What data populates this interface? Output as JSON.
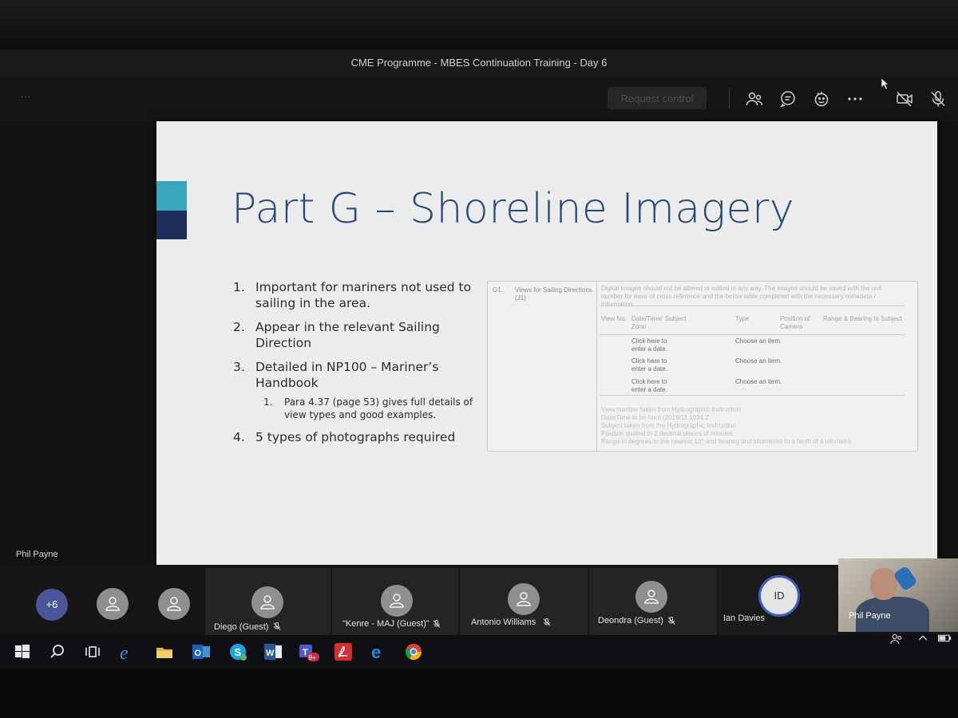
{
  "window": {
    "title": "CME Programme - MBES Continuation Training - Day 6"
  },
  "toolbar": {
    "request_control_label": "Request control",
    "left_indicator": "···"
  },
  "slide": {
    "title": "Part G – Shoreline Imagery",
    "bullets": [
      {
        "num": "1.",
        "text": "Important for mariners not used to sailing in the area."
      },
      {
        "num": "2.",
        "text": "Appear in the relevant Sailing Direction"
      },
      {
        "num": "3.",
        "text": "Detailed in NP100 – Mariner’s Handbook"
      },
      {
        "num": "1.",
        "text": "Para 4.37 (page 53) gives full details of view types and good examples.",
        "sub": true
      },
      {
        "num": "4.",
        "text": "5 types of photographs required"
      }
    ],
    "form": {
      "code": "G1.",
      "label": "Views for Sailing Directions (J1)",
      "note": "Digital images should not be altered or edited in any way. The images should be saved with the unit number for ease of cross reference and the below table completed with the necessary metadata / information.",
      "headers": [
        "View No.",
        "Date/Time/ Zone",
        "Subject",
        "Type",
        "Position of Camera",
        "Range & Bearing to Subject"
      ],
      "rows": [
        {
          "date": "Click here to enter a date.",
          "type": "Choose an item."
        },
        {
          "date": "Click here to enter a date.",
          "type": "Choose an item."
        },
        {
          "date": "Click here to enter a date.",
          "type": "Choose an item."
        }
      ],
      "footnotes": [
        "View number taken from Hydrographic Instruction",
        "Date/Time to be form (2016/11 1034 Z",
        "Subject taken from the Hydrographic Instruction",
        "Position quoted to 2 decimal places of minutes",
        "Range in degrees to the nearest 10° and bearing and kilometres to a tenth of a kilometre"
      ]
    }
  },
  "presenter": {
    "name": "Phil Payne"
  },
  "participants": {
    "more_count": "+6",
    "tiles": [
      {
        "name": "Diego (Guest)"
      },
      {
        "name": "\"Kenre - MAJ (Guest)\""
      },
      {
        "name": "Antonio Williams"
      },
      {
        "name": "Deondra (Guest)"
      },
      {
        "name": "Ian Davies",
        "initials": "ID"
      }
    ],
    "self_video_name": "Phil Payne"
  },
  "colors": {
    "slide_title": "#274a7a",
    "accent_teal": "#3aa6bd",
    "accent_navy": "#1d2e5a",
    "more_avatar": "#4a5697",
    "speaking_ring": "#3f5fc2"
  },
  "icons": [
    "people-icon",
    "chat-icon",
    "reactions-icon",
    "more-options-icon",
    "camera-off-icon",
    "mic-off-icon",
    "windows-start-icon",
    "search-icon",
    "task-view-icon",
    "edge-legacy-icon",
    "file-explorer-icon",
    "outlook-icon",
    "skype-icon",
    "word-icon",
    "teams-icon",
    "acrobat-icon",
    "edge-icon",
    "chrome-icon"
  ],
  "taskbar": {
    "teams_badge": "9+"
  }
}
